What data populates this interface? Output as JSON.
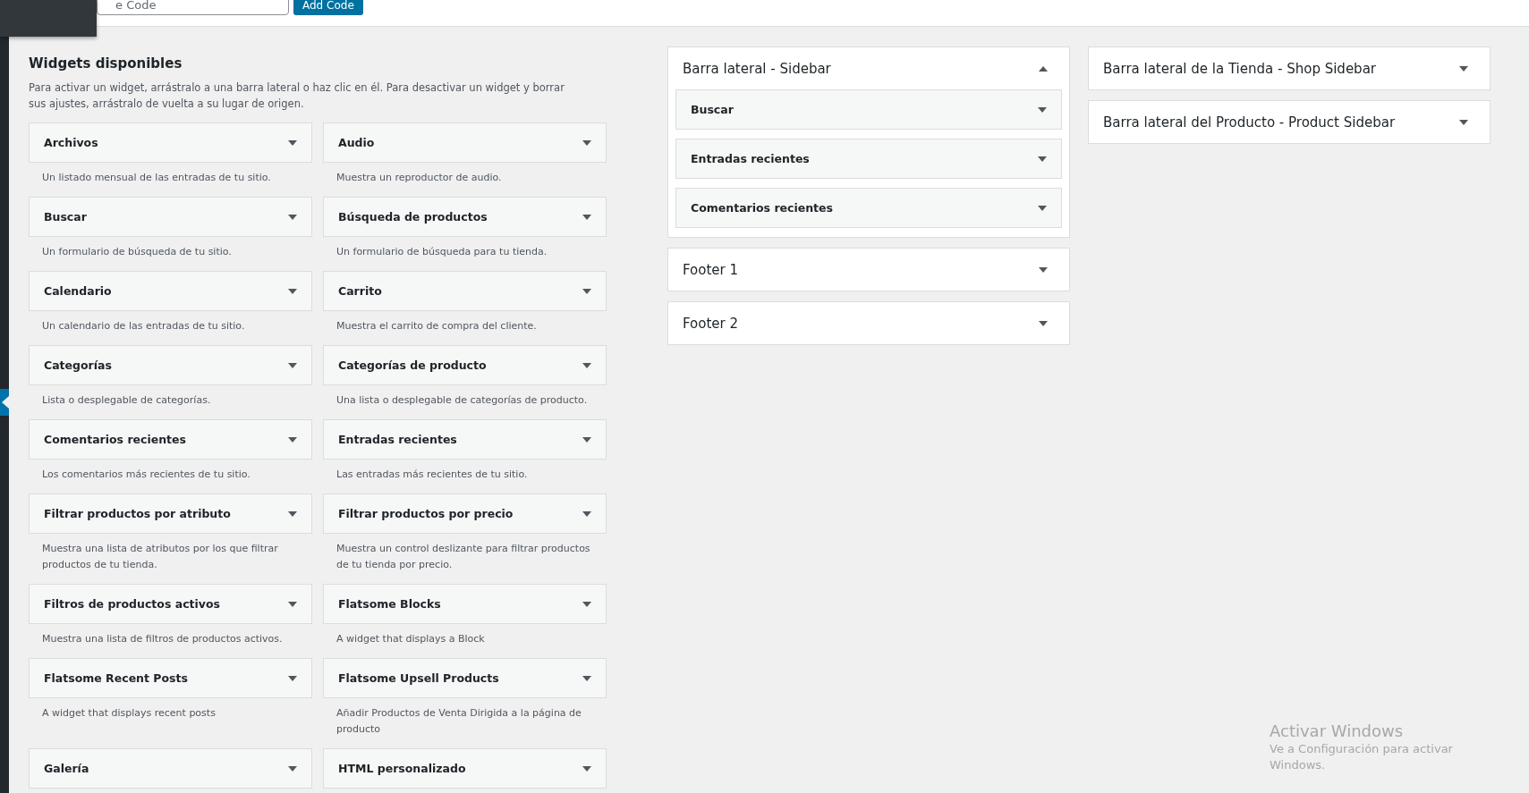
{
  "toolbar": {
    "code_field": {
      "value": "e Code"
    },
    "add_button": "Add Code"
  },
  "available": {
    "title": "Widgets disponibles",
    "description": "Para activar un widget, arrástralo a una barra lateral o haz clic en él. Para desactivar un widget y borrar sus ajustes, arrástralo de vuelta a su lugar de origen.",
    "widgets": [
      {
        "name": "Archivos",
        "description": "Un listado mensual de las entradas de tu sitio."
      },
      {
        "name": "Audio",
        "description": "Muestra un reproductor de audio."
      },
      {
        "name": "Buscar",
        "description": "Un formulario de búsqueda de tu sitio."
      },
      {
        "name": "Búsqueda de productos",
        "description": "Un formulario de búsqueda para tu tienda."
      },
      {
        "name": "Calendario",
        "description": "Un calendario de las entradas de tu sitio."
      },
      {
        "name": "Carrito",
        "description": "Muestra el carrito de compra del cliente."
      },
      {
        "name": "Categorías",
        "description": "Lista o desplegable de categorías."
      },
      {
        "name": "Categorías de producto",
        "description": "Una lista o desplegable de categorías de producto."
      },
      {
        "name": "Comentarios recientes",
        "description": "Los comentarios más recientes de tu sitio."
      },
      {
        "name": "Entradas recientes",
        "description": "Las entradas más recientes de tu sitio."
      },
      {
        "name": "Filtrar productos por atributo",
        "description": "Muestra una lista de atributos por los que filtrar productos de tu tienda."
      },
      {
        "name": "Filtrar productos por precio",
        "description": "Muestra un control deslizante para filtrar productos de tu tienda por precio."
      },
      {
        "name": "Filtros de productos activos",
        "description": "Muestra una lista de filtros de productos activos."
      },
      {
        "name": "Flatsome Blocks",
        "description": "A widget that displays a Block"
      },
      {
        "name": "Flatsome Recent Posts",
        "description": "A widget that displays recent posts"
      },
      {
        "name": "Flatsome Upsell Products",
        "description": "Añadir Productos de Venta Dirigida a la página de producto"
      },
      {
        "name": "Galería"
      },
      {
        "name": "HTML personalizado"
      }
    ]
  },
  "sidebar_columns": [
    {
      "areas": [
        {
          "title": "Barra lateral - Sidebar",
          "expanded": true,
          "widgets": [
            {
              "name": "Buscar"
            },
            {
              "name": "Entradas recientes"
            },
            {
              "name": "Comentarios recientes"
            }
          ]
        },
        {
          "title": "Footer 1",
          "expanded": false
        },
        {
          "title": "Footer 2",
          "expanded": false
        }
      ]
    },
    {
      "areas": [
        {
          "title": "Barra lateral de la Tienda - Shop Sidebar",
          "expanded": false
        },
        {
          "title": "Barra lateral del Producto - Product Sidebar",
          "expanded": false
        }
      ]
    }
  ],
  "windows_notice": {
    "title": "Activar Windows",
    "message": "Ve a Configuración para activar Windows."
  }
}
